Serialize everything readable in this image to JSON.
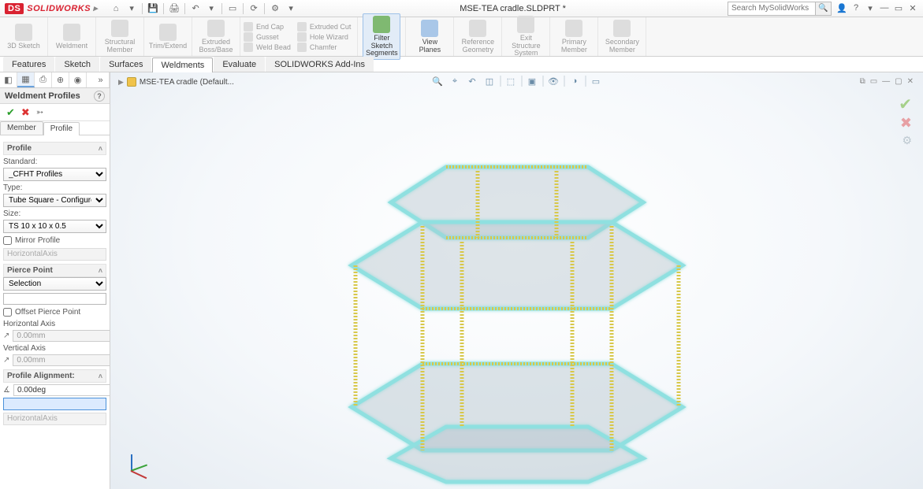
{
  "app": {
    "brand": "SOLIDWORKS",
    "doc_title": "MSE-TEA cradle.SLDPRT *",
    "search_placeholder": "Search MySolidWorks"
  },
  "ribbon": {
    "big": [
      {
        "label": "3D Sketch"
      },
      {
        "label": "Weldment"
      },
      {
        "label": "Structural Member"
      },
      {
        "label": "Trim/Extend"
      },
      {
        "label": "Extruded Boss/Base"
      }
    ],
    "smallcols": [
      [
        {
          "label": "End Cap"
        },
        {
          "label": "Gusset"
        },
        {
          "label": "Weld Bead"
        }
      ],
      [
        {
          "label": "Extruded Cut"
        },
        {
          "label": "Hole Wizard"
        },
        {
          "label": "Chamfer"
        }
      ]
    ],
    "big2": [
      {
        "label": "Filter Sketch Segments",
        "active": true
      },
      {
        "label": "View Planes",
        "enabled": true
      },
      {
        "label": "Reference Geometry"
      },
      {
        "label": "Exit Structure System"
      },
      {
        "label": "Primary Member"
      },
      {
        "label": "Secondary Member"
      }
    ]
  },
  "tabs": [
    "Features",
    "Sketch",
    "Surfaces",
    "Weldments",
    "Evaluate",
    "SOLIDWORKS Add-Ins"
  ],
  "active_tab": "Weldments",
  "breadcrumb": {
    "part": "MSE-TEA cradle  (Default..."
  },
  "pm": {
    "title": "Weldment Profiles",
    "subtabs": [
      "Member",
      "Profile"
    ],
    "active_subtab": "Profile",
    "profile": {
      "section": "Profile",
      "standard_label": "Standard:",
      "standard": "_CFHT Profiles",
      "type_label": "Type:",
      "type": "Tube Square - Configured",
      "size_label": "Size:",
      "size": "TS 10 x 10 x 0.5",
      "mirror_label": "Mirror Profile",
      "mirror_axis": "HorizontalAxis"
    },
    "pierce": {
      "section": "Pierce Point",
      "selection": "Selection",
      "offset_label": "Offset Pierce Point",
      "haxis_label": "Horizontal Axis",
      "h_value": "0.00mm",
      "vaxis_label": "Vertical Axis",
      "v_value": "0.00mm"
    },
    "align": {
      "section": "Profile Alignment:",
      "angle": "0.00deg",
      "axis": "HorizontalAxis"
    }
  }
}
